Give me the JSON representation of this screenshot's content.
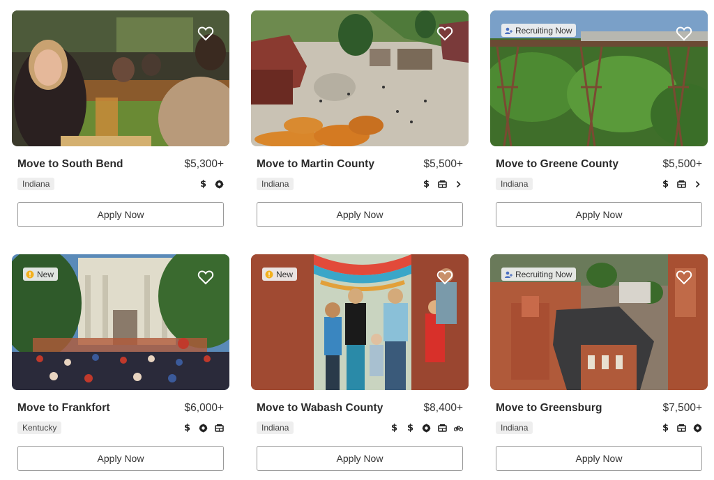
{
  "listings": [
    {
      "title": "Move to South Bend",
      "price": "$5,300+",
      "state": "Indiana",
      "badge": "",
      "perks": [
        "dollar-icon",
        "badge-icon"
      ],
      "apply_label": "Apply Now"
    },
    {
      "title": "Move to Martin County",
      "price": "$5,500+",
      "state": "Indiana",
      "badge": "",
      "perks": [
        "dollar-icon",
        "ticket-icon",
        "chevron-right-icon"
      ],
      "apply_label": "Apply Now"
    },
    {
      "title": "Move to Greene County",
      "price": "$5,500+",
      "state": "Indiana",
      "badge": "Recruiting Now",
      "perks": [
        "dollar-icon",
        "ticket-icon",
        "chevron-right-icon"
      ],
      "apply_label": "Apply Now"
    },
    {
      "title": "Move to Frankfort",
      "price": "$6,000+",
      "state": "Kentucky",
      "badge": "New",
      "perks": [
        "dollar-icon",
        "badge-icon",
        "ticket-icon"
      ],
      "apply_label": "Apply Now"
    },
    {
      "title": "Move to Wabash County",
      "price": "$8,400+",
      "state": "Indiana",
      "badge": "New",
      "perks": [
        "dollar-icon",
        "dollar-icon",
        "badge-icon",
        "ticket-icon",
        "bike-icon"
      ],
      "apply_label": "Apply Now"
    },
    {
      "title": "Move to Greensburg",
      "price": "$7,500+",
      "state": "Indiana",
      "badge": "Recruiting Now",
      "perks": [
        "dollar-icon",
        "ticket-icon",
        "badge-icon"
      ],
      "apply_label": "Apply Now"
    }
  ]
}
